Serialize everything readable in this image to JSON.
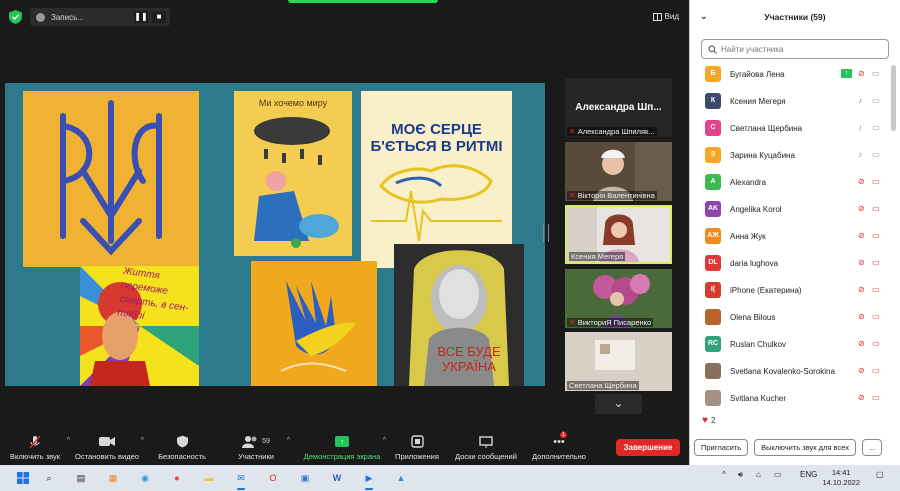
{
  "top_bar": {
    "recording_label": "Запись...",
    "pause_icon": "❚❚",
    "stop_icon": "■",
    "view_label": "Вид"
  },
  "posters": {
    "p2_title": "Ми хочемо миру",
    "p3_title": "МОЄ СЕРЦЕ Б'ЄТЬСЯ В РИТМІ",
    "p4_title": "Життя переможе смерть, в сен-тябрі",
    "p6_title": "ВСЕ БУДЕ УКРАЇНА"
  },
  "thumbnails": [
    {
      "big": "Александра  Шп...",
      "name": "Александра Шпиляк..."
    },
    {
      "name": "Вікторія Валентинівна"
    },
    {
      "name": "Ксения Мегеря"
    },
    {
      "name": "ВикториЯ Писаренко"
    },
    {
      "name": "Светлана Щербина"
    }
  ],
  "toolbar": {
    "mute": "Включить звук",
    "video": "Остановить видео",
    "security": "Безопасность",
    "participants": "Участники",
    "participants_count": "59",
    "share": "Демонстрация экрана",
    "apps": "Приложения",
    "whiteboard": "Доски сообщений",
    "more": "Дополнительно",
    "more_badge": "1",
    "end": "Завершение"
  },
  "panel": {
    "title": "Участники (59)",
    "search_placeholder": "Найти участника",
    "participants": [
      {
        "initials": "Б",
        "name": "Бугайова Лена",
        "color": "#f5a623",
        "sharing": true,
        "mic_off": true,
        "cam_off": false
      },
      {
        "initials": "К",
        "name": "Ксения Мегеря",
        "color": "#3d4a6b",
        "sharing": false,
        "mic_off": false,
        "cam_off": false
      },
      {
        "initials": "С",
        "name": "Светлана Щербина",
        "color": "#e0458b",
        "sharing": false,
        "mic_off": false,
        "cam_off": false
      },
      {
        "initials": "З",
        "name": "Зарина Куцабина",
        "color": "#f5a623",
        "sharing": false,
        "mic_off": false,
        "cam_off": false
      },
      {
        "initials": "A",
        "name": "Alexandra",
        "color": "#3fb950",
        "sharing": false,
        "mic_off": true,
        "cam_off": true
      },
      {
        "initials": "AK",
        "name": "Angelika Korol",
        "color": "#8e44ad",
        "sharing": false,
        "mic_off": true,
        "cam_off": true
      },
      {
        "initials": "АЖ",
        "name": "Анна Жук",
        "color": "#f28b1f",
        "sharing": false,
        "mic_off": true,
        "cam_off": true
      },
      {
        "initials": "DL",
        "name": "daria lughova",
        "color": "#e03838",
        "sharing": false,
        "mic_off": true,
        "cam_off": true
      },
      {
        "initials": "I(",
        "name": "iPhone (Екатерина)",
        "color": "#d63a2e",
        "sharing": false,
        "mic_off": true,
        "cam_off": true
      },
      {
        "initials": "",
        "name": "Olena Bilous",
        "color": "#b9642a",
        "sharing": false,
        "mic_off": true,
        "cam_off": true
      },
      {
        "initials": "RC",
        "name": "Ruslan Chulkov",
        "color": "#2fa37a",
        "sharing": false,
        "mic_off": true,
        "cam_off": true
      },
      {
        "initials": "",
        "name": "Svetlana Kovalenko-Sorokina",
        "color": "#8a6f5a",
        "sharing": false,
        "mic_off": true,
        "cam_off": true
      },
      {
        "initials": "",
        "name": "Svitlana Kucher",
        "color": "#a89080",
        "sharing": false,
        "mic_off": true,
        "cam_off": true
      }
    ],
    "reaction_count": "2",
    "invite": "Пригласить",
    "mute_all": "Выключить звук для всех",
    "more": "..."
  },
  "taskbar": {
    "lang": "ENG",
    "time": "14:41",
    "date": "14.10.2022"
  }
}
